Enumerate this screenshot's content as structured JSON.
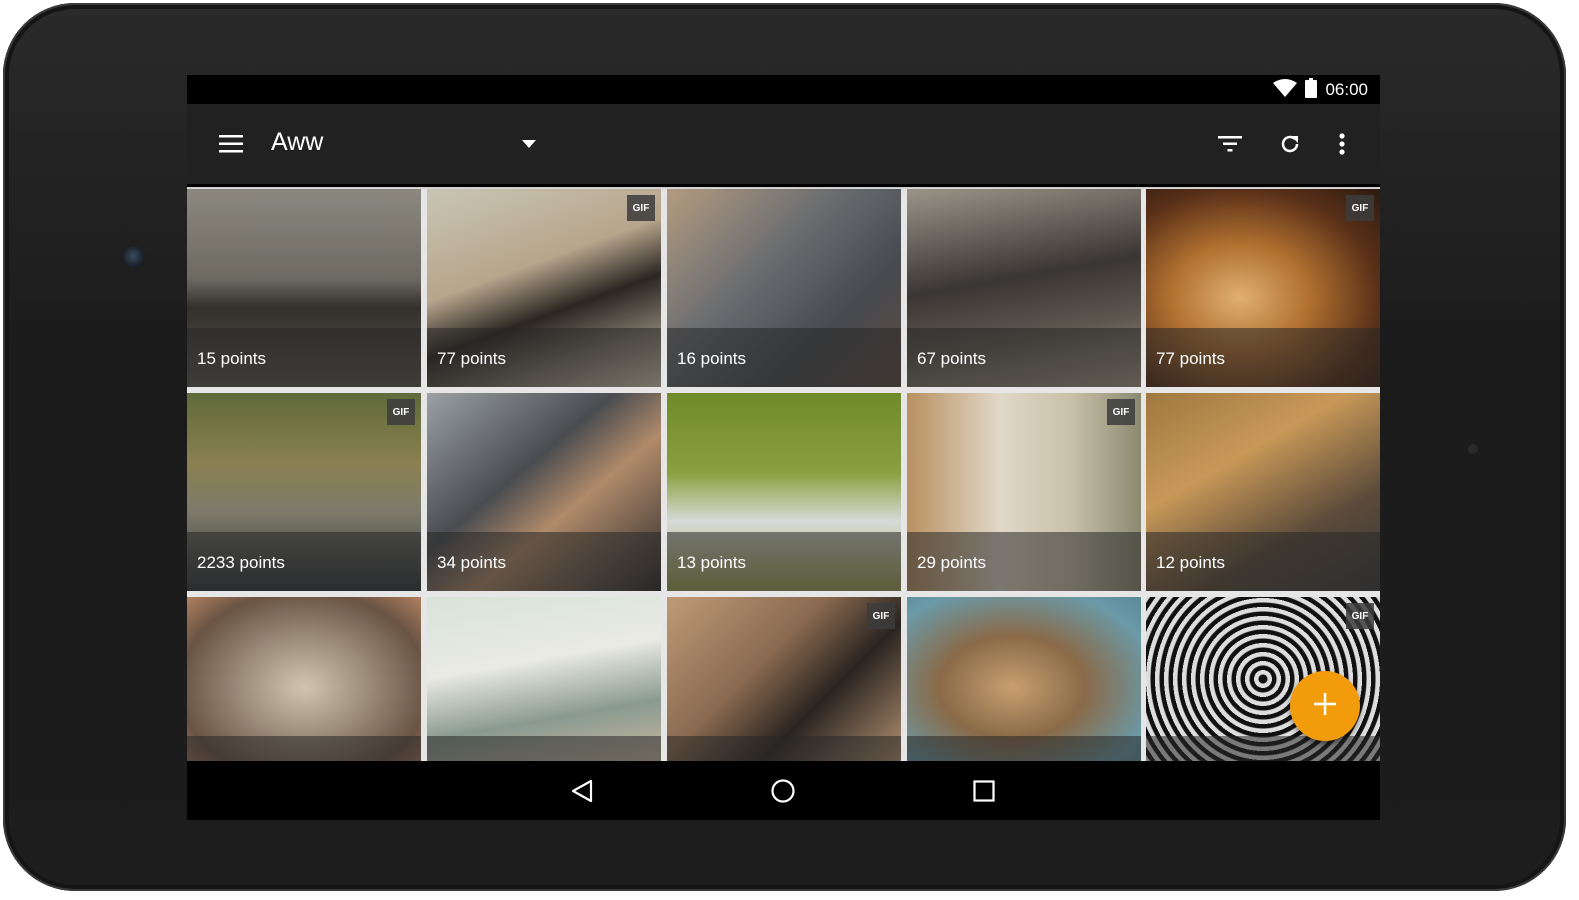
{
  "status_bar": {
    "time": "06:00",
    "icons": [
      "wifi-icon",
      "battery-icon"
    ]
  },
  "toolbar": {
    "title": "Aww",
    "icons": [
      "menu-icon",
      "dropdown-arrow-icon",
      "filter-icon",
      "refresh-icon",
      "more-vert-icon"
    ]
  },
  "posts": [
    {
      "points": "15 points",
      "gif": false
    },
    {
      "points": "77 points",
      "gif": true,
      "badge": "GIF"
    },
    {
      "points": "16 points",
      "gif": false
    },
    {
      "points": "67 points",
      "gif": false
    },
    {
      "points": "77 points",
      "gif": true,
      "badge": "GIF"
    },
    {
      "points": "2233 points",
      "gif": true,
      "badge": "GIF"
    },
    {
      "points": "34 points",
      "gif": false
    },
    {
      "points": "13 points",
      "gif": false
    },
    {
      "points": "29 points",
      "gif": true,
      "badge": "GIF"
    },
    {
      "points": "12 points",
      "gif": false
    },
    {
      "points": "",
      "gif": false
    },
    {
      "points": "",
      "gif": false
    },
    {
      "points": "",
      "gif": true,
      "badge": "GIF"
    },
    {
      "points": "",
      "gif": false
    },
    {
      "points": "",
      "gif": true,
      "badge": "GIF"
    }
  ],
  "fab": {
    "icon": "plus-icon"
  },
  "nav": {
    "icons": [
      "back-icon",
      "home-icon",
      "recents-icon"
    ]
  },
  "colors": {
    "accent": "#f29c0b",
    "toolbar": "#212121",
    "status_bar": "#000000"
  }
}
